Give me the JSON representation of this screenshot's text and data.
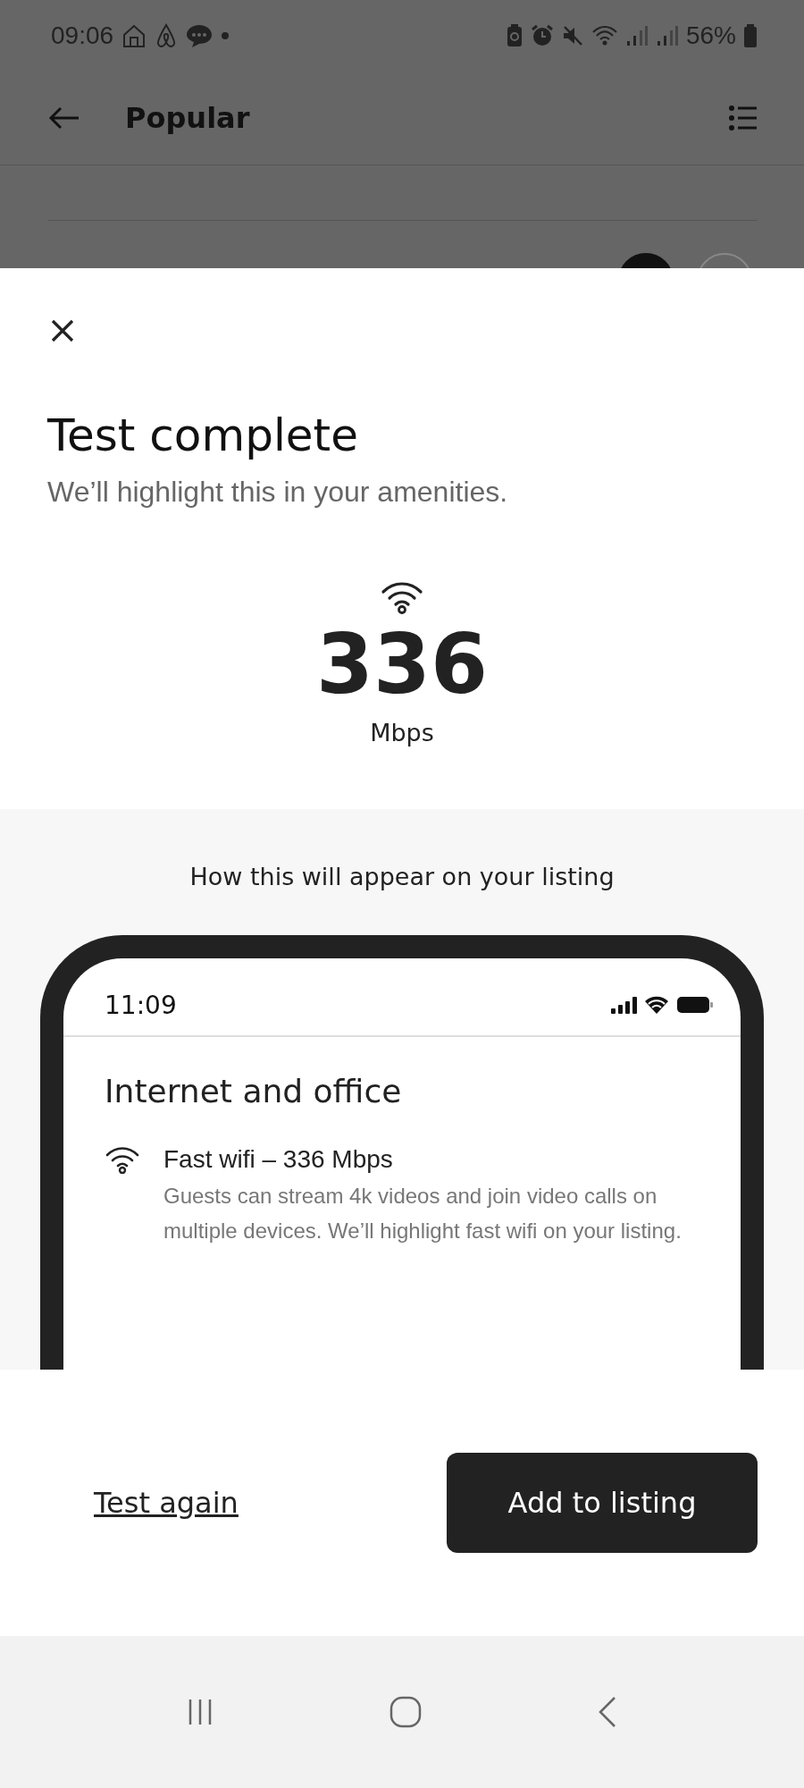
{
  "status_bar": {
    "time": "09:06",
    "battery": "56%"
  },
  "header": {
    "title": "Popular"
  },
  "sheet": {
    "title": "Test complete",
    "subtitle": "We’ll highlight this in your amenities.",
    "speed": "336",
    "unit": "Mbps"
  },
  "preview": {
    "heading": "How this will appear on your listing",
    "phone_time": "11:09",
    "section_title": "Internet and office",
    "amenity": {
      "title": "Fast wifi – 336 Mbps",
      "description": "Guests can stream 4k videos and join video calls on multiple devices. We’ll highlight fast wifi on your listing."
    }
  },
  "footer": {
    "link": "Test again",
    "button": "Add to listing"
  }
}
